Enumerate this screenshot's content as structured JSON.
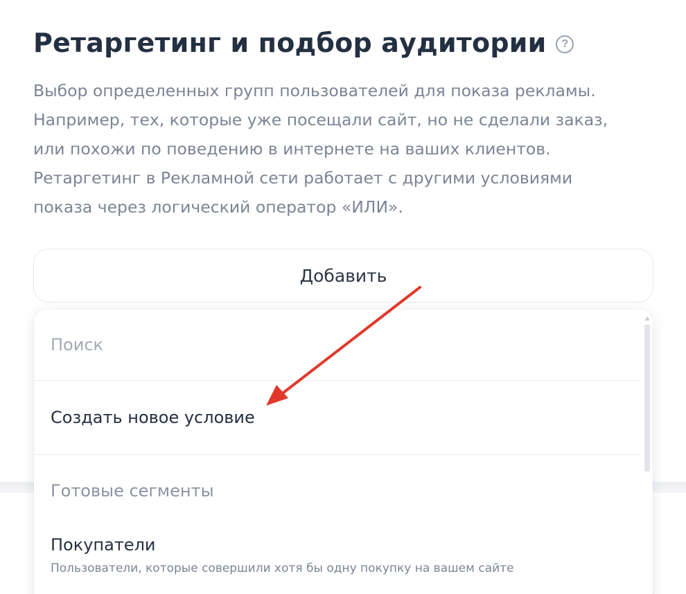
{
  "header": {
    "title": "Ретаргетинг и подбор аудитории",
    "help_icon": "question-circle-icon",
    "help_glyph": "?"
  },
  "description": {
    "lines": [
      "Выбор определенных групп пользователей для показа рекламы.",
      "Например, тех, которые уже посещали сайт, но не сделали заказ,",
      "или похожи по поведению в интернете на ваших клиентов.",
      "Ретаргетинг в Рекламной сети работает с другими условиями",
      "показа через логический оператор «ИЛИ»."
    ]
  },
  "add_button": {
    "label": "Добавить"
  },
  "dropdown": {
    "search_placeholder": "Поиск",
    "create_label": "Создать новое условие",
    "section_header": "Готовые сегменты",
    "items": [
      {
        "title": "Покупатели",
        "description": "Пользователи, которые совершили хотя бы одну покупку на вашем сайте"
      }
    ]
  },
  "colors": {
    "title": "#243042",
    "text_muted": "#7b8494",
    "annotation_arrow": "#e0392b",
    "border": "#e3e6ec"
  }
}
